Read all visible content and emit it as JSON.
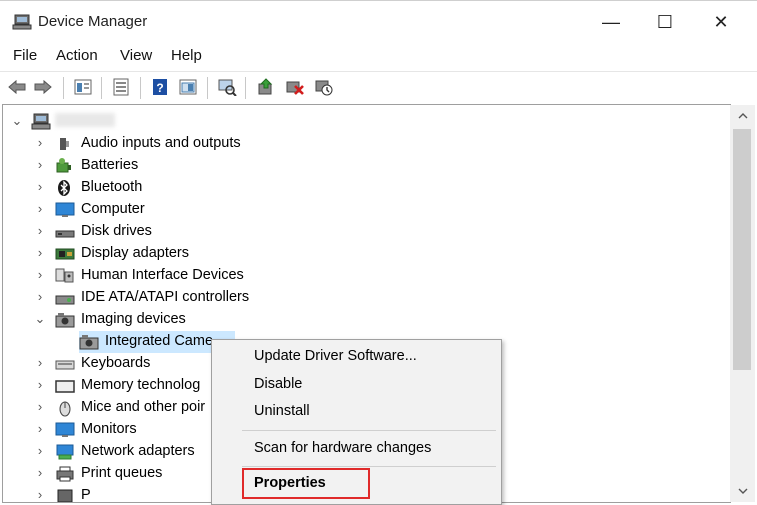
{
  "window": {
    "title": "Device Manager",
    "min_glyph": "—",
    "max_glyph": "☐",
    "close_glyph": "✕"
  },
  "menu": [
    "File",
    "Action",
    "View",
    "Help"
  ],
  "toolbar": [
    "back-icon",
    "forward-icon",
    "properties-pane-icon",
    "device-list-icon",
    "help-icon",
    "show-hide-icon",
    "scan-hardware-icon",
    "update-driver-icon",
    "uninstall-icon",
    "disable-device-icon"
  ],
  "tree": {
    "root_name": "",
    "items": [
      {
        "label": "Audio inputs and outputs",
        "icon": "speaker-icon",
        "expanded": false
      },
      {
        "label": "Batteries",
        "icon": "battery-icon",
        "expanded": false
      },
      {
        "label": "Bluetooth",
        "icon": "bluetooth-icon",
        "expanded": false
      },
      {
        "label": "Computer",
        "icon": "monitor-icon",
        "expanded": false
      },
      {
        "label": "Disk drives",
        "icon": "disk-drive-icon",
        "expanded": false
      },
      {
        "label": "Display adapters",
        "icon": "display-adapter-icon",
        "expanded": false
      },
      {
        "label": "Human Interface Devices",
        "icon": "hid-icon",
        "expanded": false
      },
      {
        "label": "IDE ATA/ATAPI controllers",
        "icon": "ide-controller-icon",
        "expanded": false
      },
      {
        "label": "Imaging devices",
        "icon": "camera-icon",
        "expanded": true
      },
      {
        "label": "Integrated Came",
        "icon": "camera-icon",
        "child": true,
        "selected": true
      },
      {
        "label": "Keyboards",
        "icon": "keyboard-icon",
        "expanded": false
      },
      {
        "label": "Memory technolog",
        "icon": "memory-icon",
        "expanded": false
      },
      {
        "label": "Mice and other poir",
        "icon": "mouse-icon",
        "expanded": false
      },
      {
        "label": "Monitors",
        "icon": "monitor-icon",
        "expanded": false
      },
      {
        "label": "Network adapters",
        "icon": "network-icon",
        "expanded": false
      },
      {
        "label": "Print queues",
        "icon": "printer-icon",
        "expanded": false
      },
      {
        "label": "P",
        "icon": "processor-icon",
        "expanded": false
      }
    ]
  },
  "context_menu": {
    "items": [
      "Update Driver Software...",
      "Disable",
      "Uninstall",
      "Scan for hardware changes",
      "Properties"
    ],
    "highlighted": "Properties",
    "highlight_color": "#e02a2a"
  },
  "colors": {
    "selection": "#cce8ff",
    "menu_bg": "#f2f2f2"
  }
}
